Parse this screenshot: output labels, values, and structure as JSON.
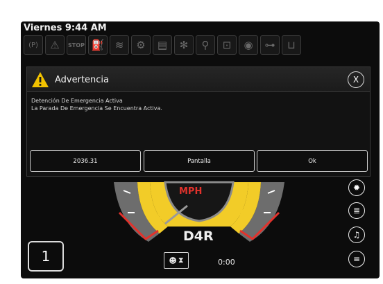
{
  "status": {
    "datetime": "Viernes 9:44 AM"
  },
  "icon_bar": [
    {
      "icon": "parking-brake-icon",
      "glyph": "(P)"
    },
    {
      "icon": "warning-icon",
      "glyph": "⚠"
    },
    {
      "icon": "stop-icon",
      "glyph": "STOP"
    },
    {
      "icon": "hydraulic-filter-icon",
      "glyph": "⛽"
    },
    {
      "icon": "coolant-level-icon",
      "glyph": "≋"
    },
    {
      "icon": "transmission-icon",
      "glyph": "⚙"
    },
    {
      "icon": "transmission-filter-icon",
      "glyph": "▤"
    },
    {
      "icon": "cooling-fan-icon",
      "glyph": "✻"
    },
    {
      "icon": "hydraulic-oil-icon",
      "glyph": "⚲"
    },
    {
      "icon": "engine-icon",
      "glyph": "⊡"
    },
    {
      "icon": "oil-pressure-icon",
      "glyph": "◉"
    },
    {
      "icon": "fuel-filter-icon",
      "glyph": "⊶"
    },
    {
      "icon": "fuel-tank-icon",
      "glyph": "⊔"
    }
  ],
  "dialog": {
    "title": "Advertencia",
    "line1": "Detención De Emergencia Activa",
    "line2": "La Parada De Emergencia Se Encuentra Activa.",
    "close_label": "X",
    "buttons": {
      "left": "2036.31",
      "middle": "Pantalla",
      "right": "Ok"
    }
  },
  "dashboard": {
    "speed_unit": "MPH",
    "scale_min": "0",
    "scale_max": "24",
    "gear": "D4R",
    "left_box_value": "1",
    "timer": "0:00"
  },
  "colors": {
    "accent_yellow": "#f2cc28",
    "warning_red": "#e2322c",
    "background": "#0c0c0c"
  }
}
